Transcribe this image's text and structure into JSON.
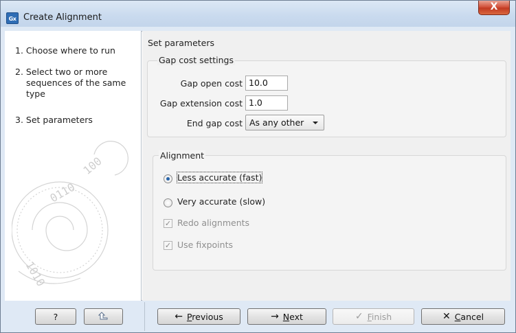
{
  "window": {
    "title": "Create Alignment",
    "app_icon_text": "Gx",
    "close_glyph": "X"
  },
  "steps": [
    {
      "num": "1.",
      "lines": [
        "Choose where to run"
      ]
    },
    {
      "num": "2.",
      "lines": [
        "Select two or more",
        "sequences of the same",
        "type"
      ]
    },
    {
      "num": "3.",
      "lines": [
        "Set parameters"
      ]
    }
  ],
  "panel": {
    "title": "Set parameters",
    "gap_group": {
      "label": "Gap cost settings",
      "gap_open": {
        "label": "Gap open cost",
        "value": "10.0"
      },
      "gap_extension": {
        "label": "Gap extension cost",
        "value": "1.0"
      },
      "end_gap": {
        "label": "End gap cost",
        "value": "As any other"
      }
    },
    "alignment_group": {
      "label": "Alignment",
      "options": [
        {
          "label": "Less accurate (fast)",
          "selected": true
        },
        {
          "label": "Very accurate (slow)",
          "selected": false
        }
      ],
      "checks": [
        {
          "label": "Redo alignments",
          "checked": true,
          "enabled": false
        },
        {
          "label": "Use fixpoints",
          "checked": true,
          "enabled": false
        }
      ]
    }
  },
  "buttons": {
    "help": "?",
    "reset_icon": "undo-icon",
    "previous": {
      "mnemonic": "P",
      "rest": "revious"
    },
    "next": {
      "mnemonic": "N",
      "rest": "ext"
    },
    "finish": {
      "mnemonic": "F",
      "rest": "inish"
    },
    "cancel": {
      "mnemonic": "C",
      "rest": "ancel"
    }
  },
  "colors": {
    "accent": "#2763a8",
    "close": "#c23a22"
  }
}
